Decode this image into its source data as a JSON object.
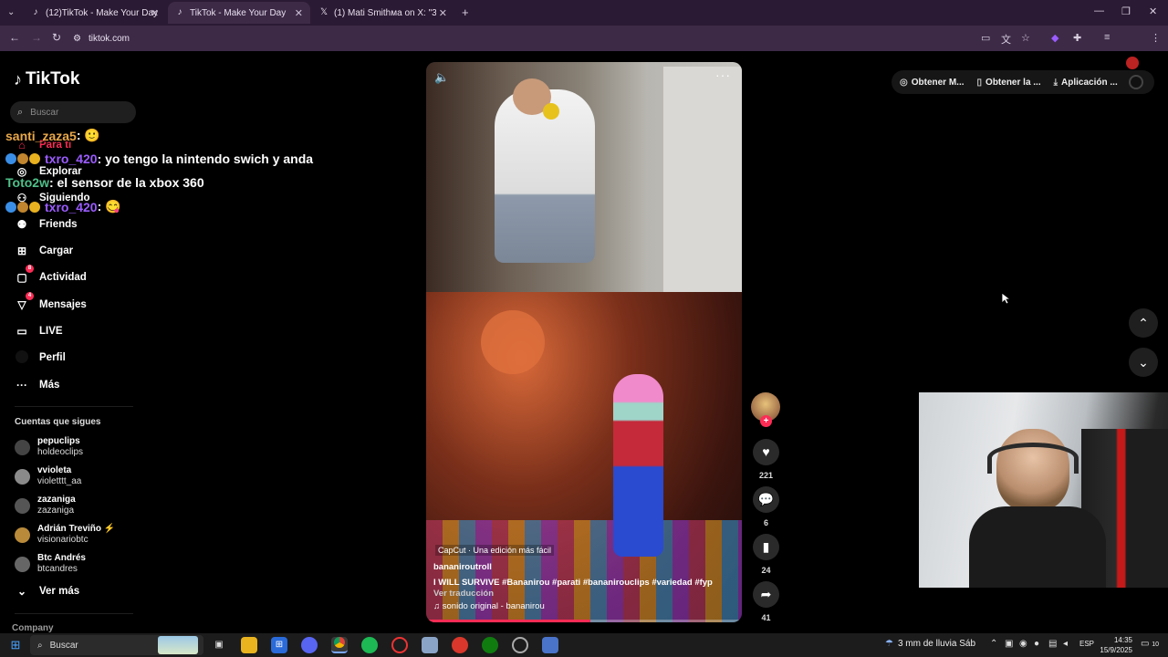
{
  "browser": {
    "tabs": [
      {
        "title": "(12)TikTok - Make Your Day",
        "icon": "tiktok-icon"
      },
      {
        "title": "TikTok - Make Your Day",
        "icon": "tiktok-icon"
      },
      {
        "title": "(1) Mati Smithмa on X: \"3 En Lo",
        "icon": "x-icon"
      }
    ],
    "url": "tiktok.com"
  },
  "sidebar": {
    "logo": "TikTok",
    "search_placeholder": "Buscar",
    "nav": [
      {
        "label": "Para ti",
        "icon": "home-icon"
      },
      {
        "label": "Explorar",
        "icon": "compass-icon"
      },
      {
        "label": "Siguiendo",
        "icon": "following-icon"
      },
      {
        "label": "Friends",
        "icon": "friends-icon"
      },
      {
        "label": "Cargar",
        "icon": "upload-icon"
      },
      {
        "label": "Actividad",
        "icon": "activity-icon",
        "badge": "8"
      },
      {
        "label": "Mensajes",
        "icon": "messages-icon",
        "badge": "4"
      },
      {
        "label": "LIVE",
        "icon": "live-icon"
      },
      {
        "label": "Perfil",
        "icon": "profile-icon"
      },
      {
        "label": "Más",
        "icon": "more-icon"
      }
    ],
    "following_title": "Cuentas que sigues",
    "accounts": [
      {
        "name": "pepuclips",
        "handle": "holdeoclips",
        "color": "#444"
      },
      {
        "name": "vvioleta",
        "handle": "violetttt_aa",
        "color": "#8a8a8a"
      },
      {
        "name": "zazaniga",
        "handle": "zazaniga",
        "color": "#555"
      },
      {
        "name": "Adrián Treviño ⚡",
        "handle": "visionariobtc",
        "color": "#b88a3a"
      },
      {
        "name": "Btc Andrés",
        "handle": "btcandres",
        "color": "#666"
      }
    ],
    "see_more": "Ver más",
    "company": "Company"
  },
  "chat": [
    {
      "user": "santi_zaza5",
      "message": " : 🙂"
    },
    {
      "user": "txro_420",
      "message": " : yo tengo la nintendo swich y anda"
    },
    {
      "user": "Toto2w",
      "message": " : el sensor de la xbox 360"
    },
    {
      "user": "txro_420",
      "message": " : 😋"
    }
  ],
  "video": {
    "capcut": "CapCut · Una edición más fácil",
    "author": "bananiroutroll",
    "description": "I WILL SURVIVE #Bananirou  #parati  #bananirouclips  #variedad  #fyp",
    "translate": "Ver traducción",
    "sound": "♫ sonido original - bananirou",
    "progress": 0.52
  },
  "actions": {
    "likes": "221",
    "comments": "6",
    "saves": "24",
    "shares": "41"
  },
  "topbar": {
    "btn1": "Obtener M...",
    "btn2": "Obtener la ...",
    "btn3": "Aplicación ..."
  },
  "taskbar": {
    "search": "Buscar",
    "weather": "3 mm de lluvia Sáb",
    "lang": "ESP",
    "time": "14:35",
    "date": "15/9/2025",
    "notifications": "10"
  }
}
